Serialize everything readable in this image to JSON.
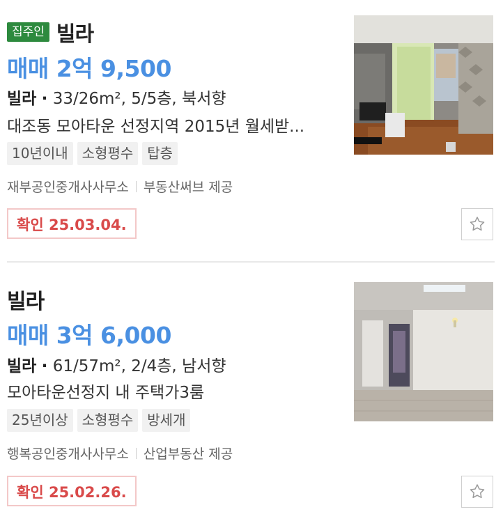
{
  "listings": [
    {
      "badge": "집주인",
      "type": "빌라",
      "price": "매매 2억 9,500",
      "spec_type": "빌라",
      "spec_dot": "·",
      "spec_detail": "33/26m², 5/5층, 북서향",
      "description": "대조동 모아타운 선정지역 2015년 월세받...",
      "tags": [
        "10년이내",
        "소형평수",
        "탑층"
      ],
      "agency": "재부공인중개사사무소",
      "provider": "부동산써브 제공",
      "confirmed": "확인 25.03.04.",
      "favorite_icon": "star-outline-icon"
    },
    {
      "badge": "",
      "type": "빌라",
      "price": "매매 3억 6,000",
      "spec_type": "빌라",
      "spec_dot": "·",
      "spec_detail": "61/57m², 2/4층, 남서향",
      "description": "모아타운선정지 내 주택가3룸",
      "tags": [
        "25년이상",
        "소형평수",
        "방세개"
      ],
      "agency": "행복공인중개사사무소",
      "provider": "산업부동산 제공",
      "confirmed": "확인 25.02.26.",
      "favorite_icon": "star-outline-icon"
    }
  ],
  "colors": {
    "price": "#4a90e2",
    "owner_badge": "#2d8a3e",
    "confirm_text": "#d94a4a",
    "confirm_border": "#f3c8c8",
    "tag_bg": "#f1f1f1"
  }
}
